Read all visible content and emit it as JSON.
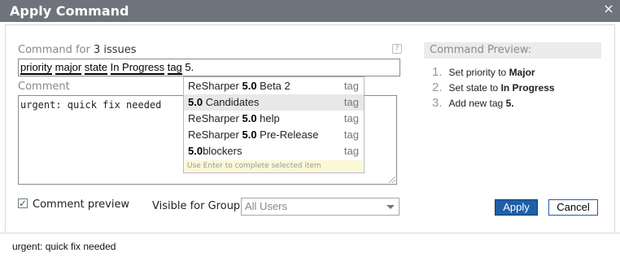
{
  "dialog": {
    "title": "Apply Command",
    "close_glyph": "×"
  },
  "command": {
    "label_prefix": "Command for",
    "issue_count": "3 issues",
    "help_glyph": "?",
    "tokens": [
      "priority",
      "major",
      "state",
      "In Progress",
      "tag",
      "5."
    ]
  },
  "comment": {
    "label": "Comment",
    "value": "urgent: quick fix needed"
  },
  "suggestions": {
    "items": [
      {
        "before": "ReSharper ",
        "match": "5.0",
        "after": " Beta 2",
        "type": "tag"
      },
      {
        "before": "",
        "match": "5.0",
        "after": " Candidates",
        "type": "tag"
      },
      {
        "before": "ReSharper ",
        "match": "5.0",
        "after": " help",
        "type": "tag"
      },
      {
        "before": "ReSharper ",
        "match": "5.0",
        "after": " Pre-Release",
        "type": "tag"
      },
      {
        "before": "",
        "match": "5.0",
        "after": "blockers",
        "type": "tag"
      }
    ],
    "selected_index": 1,
    "hint": "Use Enter to complete selected item"
  },
  "preview": {
    "title": "Command Preview:",
    "items": [
      {
        "num": "1.",
        "text": "Set priority to",
        "value": "Major"
      },
      {
        "num": "2.",
        "text": "Set state to",
        "value": "In Progress"
      },
      {
        "num": "3.",
        "text": "Add new tag",
        "value": "5."
      }
    ]
  },
  "options": {
    "comment_preview_label": "Comment preview",
    "comment_preview_checked": true,
    "check_glyph": "✓",
    "visible_group_label": "Visible for Group:",
    "visible_group_value": "All Users"
  },
  "buttons": {
    "apply": "Apply",
    "cancel": "Cancel"
  },
  "status": {
    "comment_preview_text": "urgent: quick fix needed"
  },
  "colors": {
    "titlebar": "#6f747c",
    "apply_button": "#1e5fa8",
    "hint_background": "#fbf8d6"
  }
}
